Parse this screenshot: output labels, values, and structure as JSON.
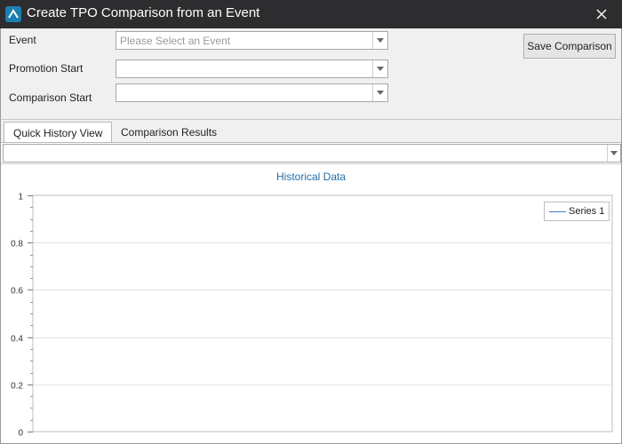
{
  "window": {
    "title": "Create TPO Comparison from an Event"
  },
  "form": {
    "event_label": "Event",
    "event_placeholder": "Please Select an Event",
    "promotion_start_label": "Promotion Start",
    "comparison_start_label": "Comparison Start",
    "save_button": "Save Comparison"
  },
  "tabs": [
    {
      "label": "Quick History View",
      "active": true
    },
    {
      "label": "Comparison Results",
      "active": false
    }
  ],
  "chart_data": {
    "type": "line",
    "title": "Historical Data",
    "xlabel": "",
    "ylabel": "",
    "ylim": [
      0,
      1
    ],
    "yticks": [
      "1",
      "0.8",
      "0.6",
      "0.4",
      "0.2",
      "0"
    ],
    "series": [
      {
        "name": "Series 1",
        "values": [],
        "color": "#3f7fc0"
      }
    ],
    "grid": true,
    "legend": "top-right"
  },
  "colors": {
    "titlebar": "#2d2d30",
    "accent": "#1d7fb0",
    "chart_title": "#1f6da8",
    "series_line": "#3f7fc0"
  }
}
